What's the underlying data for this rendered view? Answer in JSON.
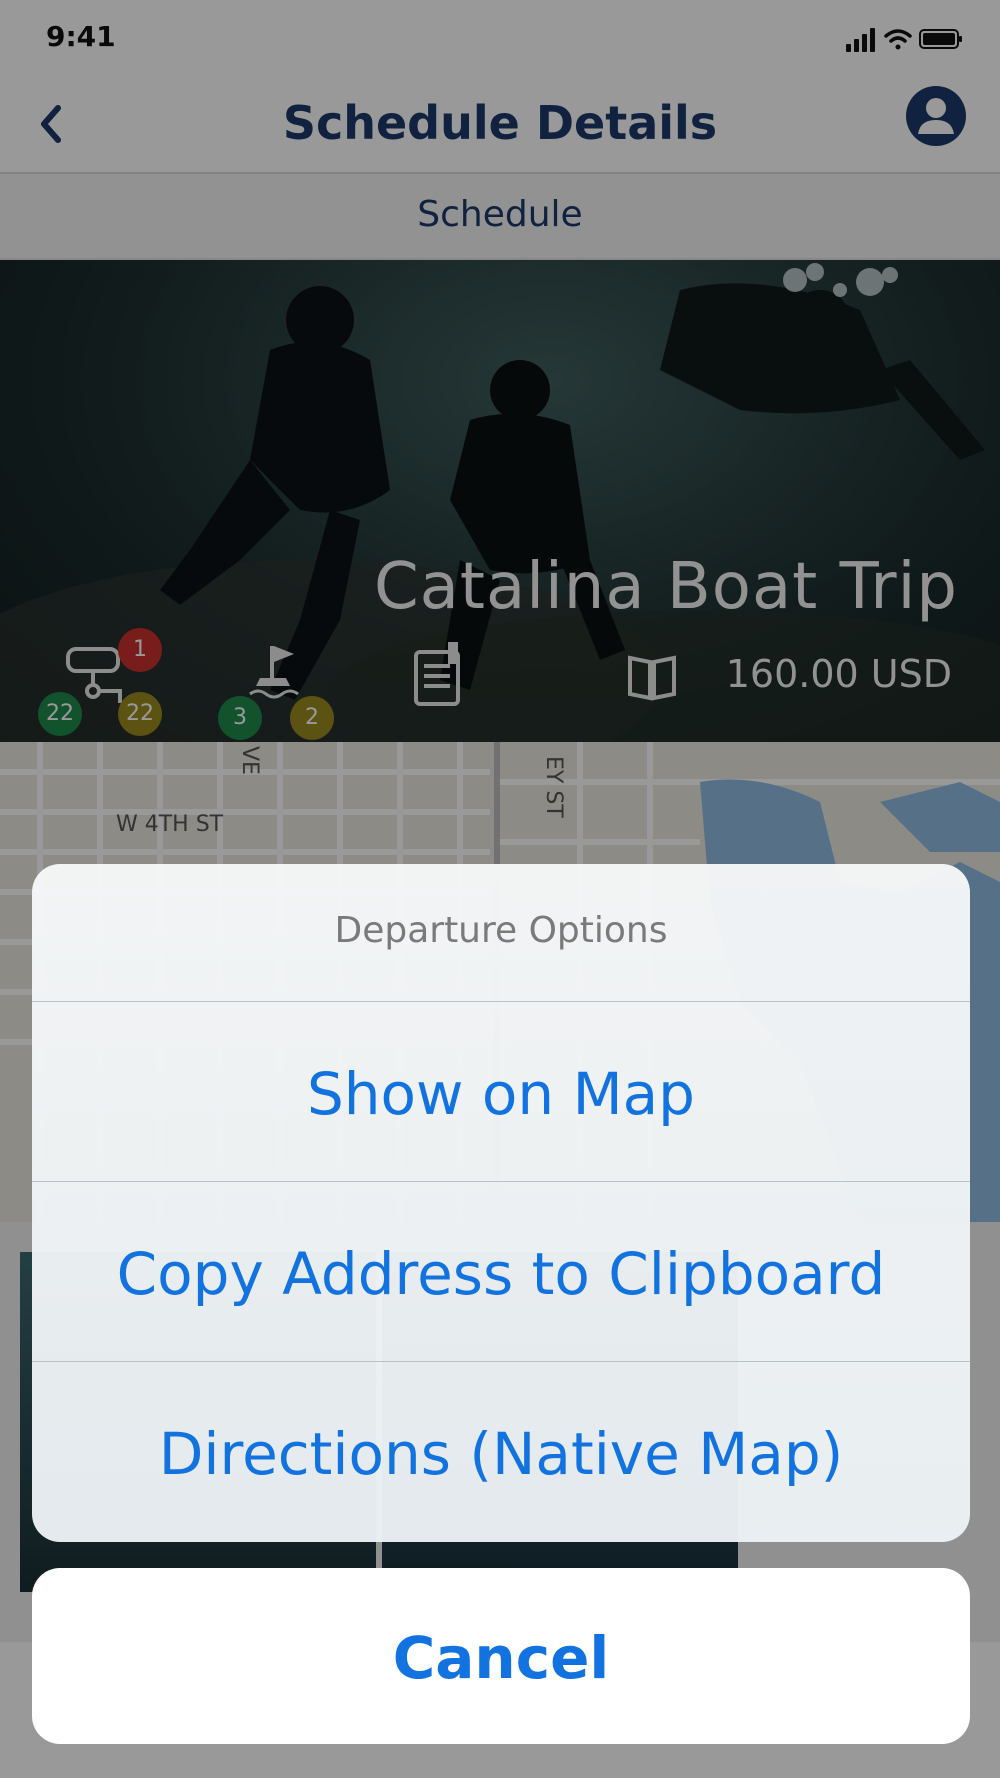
{
  "status_bar": {
    "time": "9:41"
  },
  "nav": {
    "title": "Schedule Details",
    "back_icon": "chevron-left-icon",
    "profile_icon": "person-circle-icon"
  },
  "sub_header": {
    "title": "Schedule"
  },
  "trip": {
    "title": "Catalina Boat Trip",
    "price": "160.00 USD",
    "badges": {
      "divers_top": "1",
      "divers_left": "22",
      "divers_right": "22",
      "boat_left": "3",
      "boat_right": "2"
    }
  },
  "map": {
    "street_label_1": "W 4TH ST",
    "street_label_2": "EY ST",
    "street_label_3": "VE"
  },
  "action_sheet": {
    "title": "Departure Options",
    "options": [
      {
        "label": "Show on Map"
      },
      {
        "label": "Copy Address to Clipboard"
      },
      {
        "label": "Directions (Native Map)"
      }
    ],
    "cancel_label": "Cancel"
  },
  "colors": {
    "nav_title": "#1b3a6b",
    "action_blue": "#1273e0",
    "badge_red": "#c8302f",
    "badge_green": "#1f8a4c",
    "badge_olive": "#9a8a1e"
  }
}
